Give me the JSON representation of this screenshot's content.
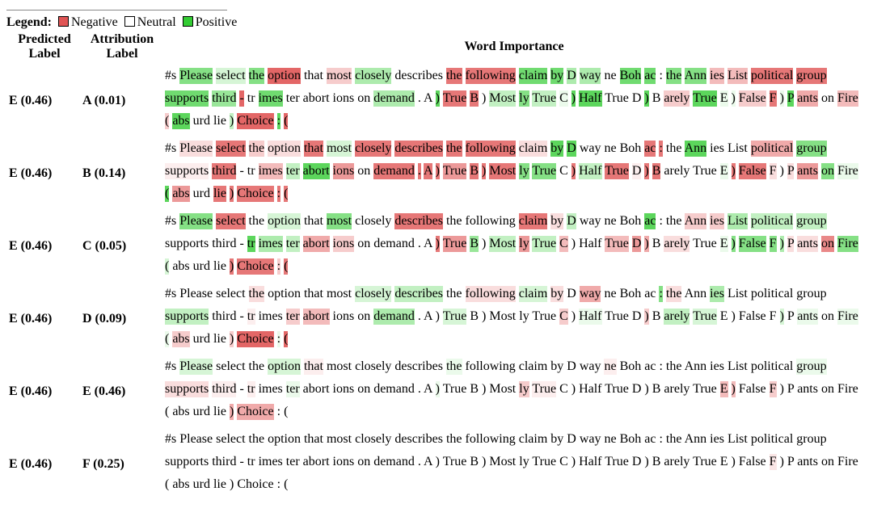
{
  "legend": {
    "title": "Legend:",
    "items": [
      {
        "label": "Negative",
        "color": "#e05555"
      },
      {
        "label": "Neutral",
        "color": "#ffffff"
      },
      {
        "label": "Positive",
        "color": "#33cc33"
      }
    ]
  },
  "headers": {
    "predicted": "Predicted Label",
    "attribution": "Attribution Label",
    "word_importance": "Word Importance"
  },
  "tokens": [
    "#s",
    "Please",
    "select",
    "the",
    "option",
    "that",
    "most",
    "closely",
    "describes",
    "the",
    "following",
    "claim",
    "by",
    "D",
    "way",
    "ne",
    "Boh",
    "ac",
    ":",
    "the",
    "Ann",
    "ies",
    "List",
    "political",
    "group",
    "supports",
    "third",
    "-",
    "tr",
    "imes",
    "ter",
    "abort",
    "ions",
    "on",
    "demand",
    ".",
    "A",
    ")",
    "True",
    "B",
    ")",
    "Most",
    "ly",
    "True",
    "C",
    ")",
    "Half",
    "True",
    "D",
    ")",
    "B",
    "arely",
    "True",
    "E",
    ")",
    "False",
    "F",
    ")",
    "P",
    "ants",
    "on",
    "Fire",
    "(",
    "abs",
    "urd",
    "lie",
    ")",
    "Choice",
    ":",
    "("
  ],
  "rows": [
    {
      "predicted": "E (0.46)",
      "attribution": "A (0.01)",
      "weights": [
        0,
        0.6,
        0.2,
        0.6,
        -0.9,
        0,
        -0.3,
        0.4,
        0,
        -0.8,
        -0.8,
        0.7,
        0.7,
        0.4,
        0.4,
        0,
        0.7,
        0.7,
        0,
        0.6,
        0.6,
        -0.4,
        -0.4,
        -0.8,
        -0.8,
        0.7,
        0.5,
        -0.9,
        0,
        0.7,
        0,
        0,
        0,
        0,
        0.4,
        0,
        0,
        0.8,
        -0.8,
        -0.8,
        0,
        0.3,
        0.6,
        0.3,
        0.1,
        0.8,
        0.8,
        0,
        0,
        0.8,
        0,
        -0.3,
        0.8,
        0.1,
        0.1,
        -0.3,
        -0.8,
        0.1,
        0.8,
        -0.5,
        0,
        -0.4,
        -0.3,
        0.8,
        0,
        0,
        0.3,
        -0.9,
        0.8,
        -0.9
      ]
    },
    {
      "predicted": "E (0.46)",
      "attribution": "B (0.14)",
      "weights": [
        0,
        -0.2,
        -0.8,
        -0.3,
        -0.2,
        -0.8,
        0.2,
        -0.8,
        -0.8,
        -0.8,
        -0.8,
        -0.2,
        0.8,
        0.8,
        0,
        0,
        0,
        -0.8,
        -0.8,
        0,
        0.8,
        0,
        0,
        -0.5,
        0.6,
        -0.1,
        -0.8,
        0,
        0,
        -0.4,
        0.3,
        0.8,
        -0.6,
        0,
        -0.8,
        -0.8,
        -0.8,
        -0.8,
        -0.6,
        -0.8,
        -0.8,
        -0.8,
        0.6,
        0.6,
        0,
        -0.8,
        0.3,
        -0.8,
        -0.1,
        -0.8,
        -0.8,
        0,
        0,
        0.1,
        -0.8,
        -0.8,
        -0.2,
        0,
        -0.2,
        -0.6,
        0.6,
        0.1,
        0.8,
        -0.6,
        0,
        -0.8,
        -0.8,
        -0.8,
        -0.8,
        -0.8
      ]
    },
    {
      "predicted": "E (0.46)",
      "attribution": "C (0.05)",
      "weights": [
        0,
        0.6,
        -0.8,
        0,
        0.2,
        0,
        0.6,
        0,
        -0.8,
        0,
        0,
        -0.8,
        -0.2,
        0.3,
        0,
        0,
        0,
        0.8,
        0,
        0,
        -0.3,
        -0.3,
        0.4,
        0.3,
        0.3,
        0,
        0,
        0,
        0.8,
        0.4,
        0.3,
        -0.5,
        -0.3,
        0,
        0,
        0,
        0,
        -0.8,
        -0.6,
        0.5,
        0,
        0.3,
        -0.6,
        0.3,
        -0.4,
        0,
        0,
        -0.4,
        -0.6,
        -0.5,
        0,
        -0.2,
        0,
        0.1,
        0.6,
        0.6,
        0.6,
        0.4,
        -0.2,
        -0.2,
        -0.7,
        0.6,
        0.2,
        0,
        0,
        0,
        -0.8,
        -0.8,
        -0.3,
        -0.8
      ]
    },
    {
      "predicted": "E (0.46)",
      "attribution": "D (0.09)",
      "weights": [
        0,
        0,
        0,
        -0.2,
        0,
        0,
        0,
        0.2,
        0.3,
        0,
        -0.2,
        0.2,
        -0.2,
        0,
        -0.5,
        0,
        0,
        0,
        0.6,
        -0.2,
        0,
        0.4,
        0,
        0,
        0,
        0.3,
        0,
        0,
        -0.1,
        0,
        -0.3,
        -0.4,
        0,
        0,
        0.4,
        0,
        0,
        0,
        0.2,
        0,
        0,
        0,
        0,
        0,
        -0.3,
        0,
        0.1,
        0,
        0,
        -0.3,
        0,
        0.3,
        0.2,
        0,
        0,
        0,
        0,
        0.2,
        0,
        0.1,
        0,
        0.1,
        0.1,
        -0.3,
        0,
        0,
        -0.3,
        -0.9,
        0.1,
        -0.9
      ]
    },
    {
      "predicted": "E (0.46)",
      "attribution": "E (0.46)",
      "weights": [
        0,
        0.2,
        0,
        0,
        0.2,
        -0.1,
        0,
        0,
        0,
        0.1,
        0,
        0,
        0,
        0,
        0,
        -0.1,
        0,
        0,
        0,
        0,
        0,
        0,
        0,
        0,
        0.1,
        -0.2,
        -0.1,
        0,
        -0.1,
        0,
        0.1,
        0,
        0,
        0,
        0,
        0,
        0,
        0.1,
        0,
        0,
        0,
        0,
        -0.3,
        -0.1,
        0,
        0,
        0,
        0,
        0,
        0,
        0,
        0,
        0,
        -0.4,
        -0.4,
        0,
        -0.3,
        0,
        0,
        0,
        0,
        0,
        0,
        0,
        0,
        0,
        -0.5,
        -0.5,
        0,
        0
      ]
    },
    {
      "predicted": "E (0.46)",
      "attribution": "F (0.25)",
      "weights": [
        0,
        0,
        0,
        0,
        0,
        0,
        0,
        0,
        0,
        0,
        0,
        0,
        0,
        0,
        0,
        0,
        0,
        0,
        0,
        0,
        0,
        0,
        0,
        0,
        0,
        0,
        0,
        0,
        0,
        0,
        0,
        0,
        0,
        0,
        0,
        0,
        0,
        0,
        0,
        0,
        0,
        0,
        0,
        0,
        0,
        0,
        0,
        0,
        0,
        0,
        0,
        0,
        0,
        0,
        0,
        0,
        -0.15,
        0,
        0,
        0,
        0,
        0,
        0,
        0,
        0,
        0,
        0,
        0,
        0,
        0
      ]
    }
  ]
}
